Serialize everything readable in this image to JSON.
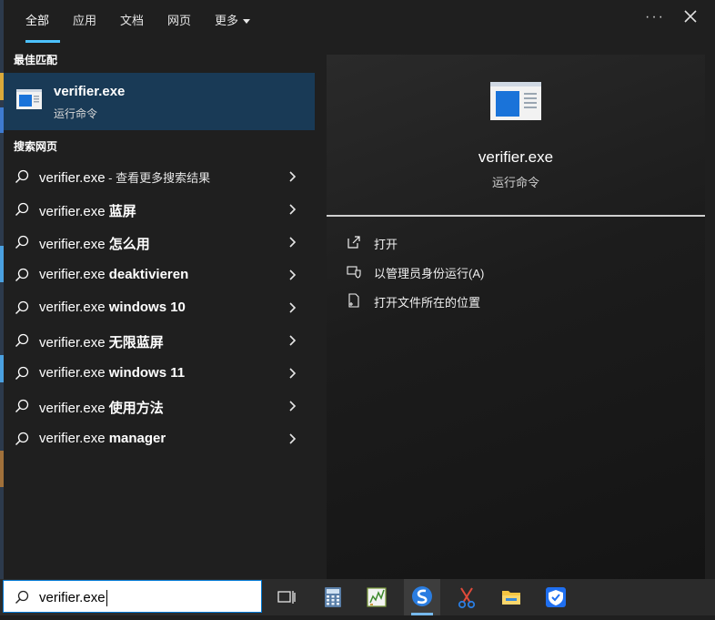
{
  "tabs": [
    {
      "label": "全部",
      "active": true
    },
    {
      "label": "应用",
      "active": false
    },
    {
      "label": "文档",
      "active": false
    },
    {
      "label": "网页",
      "active": false
    },
    {
      "label": "更多",
      "active": false,
      "dropdown": true
    }
  ],
  "window_controls": {
    "more_label": "···"
  },
  "best_match": {
    "section_title": "最佳匹配",
    "name": "verifier.exe",
    "subtitle": "运行命令",
    "icon": "window-app-icon"
  },
  "web_search": {
    "section_title": "搜索网页",
    "suggestions": [
      {
        "prefix": "verifier.exe",
        "suffix": " - 查看更多搜索结果",
        "suffix_style": "small"
      },
      {
        "prefix": "verifier.exe",
        "suffix": " 蓝屏",
        "suffix_style": "bold"
      },
      {
        "prefix": "verifier.exe",
        "suffix": " 怎么用",
        "suffix_style": "bold"
      },
      {
        "prefix": "verifier.exe",
        "suffix": " deaktivieren",
        "suffix_style": "bold"
      },
      {
        "prefix": "verifier.exe",
        "suffix": " windows 10",
        "suffix_style": "bold"
      },
      {
        "prefix": "verifier.exe",
        "suffix": " 无限蓝屏",
        "suffix_style": "bold"
      },
      {
        "prefix": "verifier.exe",
        "suffix": " windows 11",
        "suffix_style": "bold"
      },
      {
        "prefix": "verifier.exe",
        "suffix": " 使用方法",
        "suffix_style": "bold"
      },
      {
        "prefix": "verifier.exe",
        "suffix": " manager",
        "suffix_style": "bold"
      }
    ]
  },
  "detail": {
    "name": "verifier.exe",
    "subtitle": "运行命令",
    "actions": [
      {
        "label": "打开",
        "icon": "open-icon"
      },
      {
        "label": "以管理员身份运行(A)",
        "icon": "shield-icon"
      },
      {
        "label": "打开文件所在的位置",
        "icon": "file-location-icon"
      }
    ]
  },
  "taskbar": {
    "search_value": "verifier.exe",
    "apps": [
      {
        "name": "task-view-icon"
      },
      {
        "name": "calculator-icon"
      },
      {
        "name": "chart-app-icon"
      },
      {
        "name": "sogou-icon",
        "active": true
      },
      {
        "name": "snipping-tool-icon"
      },
      {
        "name": "file-explorer-icon"
      },
      {
        "name": "security-shield-app-icon"
      }
    ]
  },
  "colors": {
    "accent": "#4cc2ff",
    "selected_row": "#193a56",
    "taskbar": "#2b2b2b"
  }
}
